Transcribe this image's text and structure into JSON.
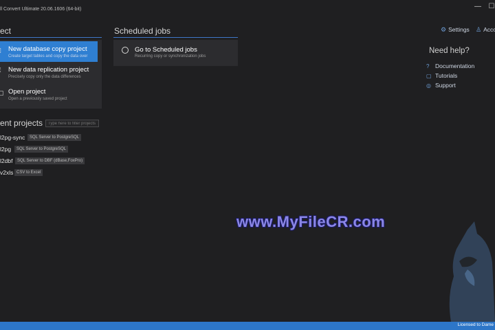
{
  "window": {
    "title": "ll Convert Ultimate 20.06.1606 (64-bit)",
    "minimize_glyph": "—",
    "maximize_glyph": "☐"
  },
  "project": {
    "heading": "ect",
    "items": [
      {
        "label": "New database copy project",
        "sub": "Create target tables and copy the data over",
        "icon": "database-copy-icon",
        "active": true
      },
      {
        "label": "New data replication project",
        "sub": "Precisely copy only the data differences",
        "icon": "replication-icon",
        "active": false
      },
      {
        "label": "Open project",
        "sub": "Open a previously saved project",
        "icon": "open-folder-icon",
        "active": false
      }
    ]
  },
  "scheduled": {
    "heading": "Scheduled jobs",
    "card_label": "Go to Scheduled jobs",
    "card_sub": "Recurring copy or synchronization jobs"
  },
  "recent": {
    "heading": "ent projects",
    "filter_placeholder": "Type here to filter projects",
    "rows": [
      {
        "name": "l2pg-sync",
        "badge": "SQL Server to PostgreSQL"
      },
      {
        "name": "l2pg",
        "badge": "SQL Server to PostgreSQL"
      },
      {
        "name": "l2dbf",
        "badge": "SQL Server to DBF (dBase,FoxPro)"
      },
      {
        "name": "v2xls",
        "badge": "CSV to Excel"
      }
    ]
  },
  "top_links": {
    "settings": "Settings",
    "account": "Acco"
  },
  "help": {
    "heading": "Need help?",
    "links": [
      {
        "label": "Documentation",
        "icon": "help-circle-icon"
      },
      {
        "label": "Tutorials",
        "icon": "tutorial-icon"
      },
      {
        "label": "Support",
        "icon": "globe-icon"
      }
    ]
  },
  "watermark": "www.MyFileCR.com",
  "status": {
    "license": "Licensed to Dame"
  },
  "colors": {
    "accent": "#2f7fd2",
    "statusbar": "#2d76c8",
    "background": "#1f1f21",
    "panel": "#2c2c2f"
  }
}
